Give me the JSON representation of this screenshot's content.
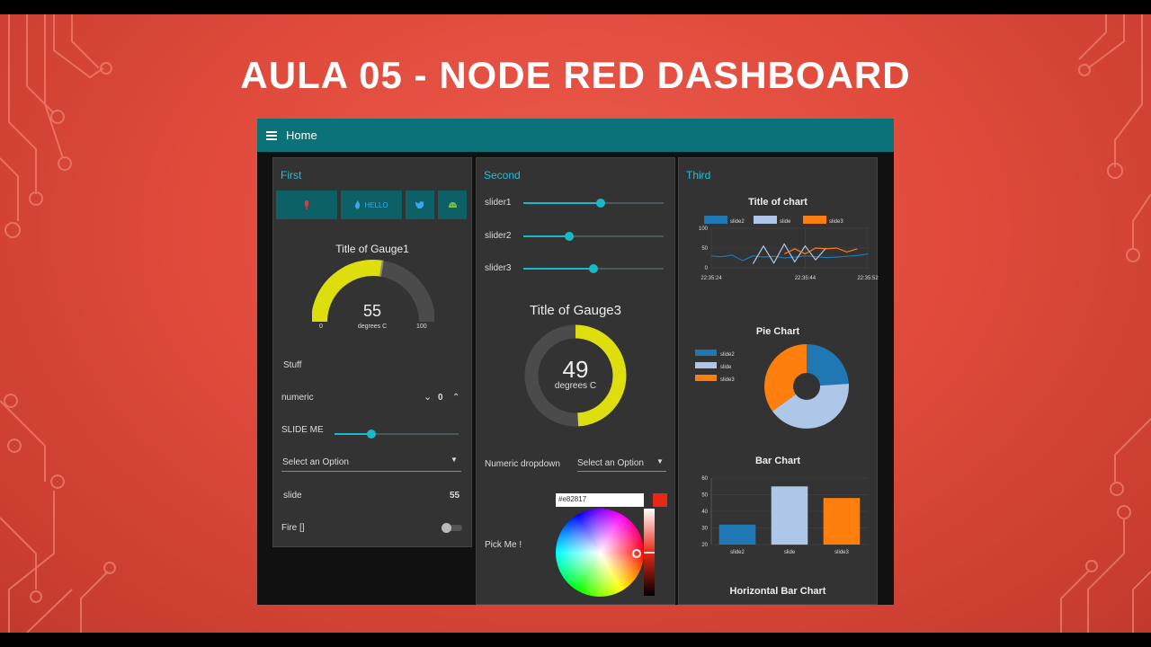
{
  "slide": {
    "title": "AULA 05 - NODE RED DASHBOARD"
  },
  "topbar": {
    "title": "Home",
    "menu_icon": "hamburger-icon"
  },
  "first": {
    "title": "First",
    "buttons": [
      {
        "icon": "microphone-icon",
        "label": "",
        "color": "#e53935"
      },
      {
        "icon": "fire-icon",
        "label": "HELLO",
        "color": "#3aa7e8"
      },
      {
        "icon": "twitter-icon",
        "label": "",
        "color": "#3aa7e8"
      },
      {
        "icon": "android-icon",
        "label": "",
        "color": "#7cc242"
      }
    ],
    "gauge": {
      "title": "Title of Gauge1",
      "value": "55",
      "units": "degrees C",
      "min": "0",
      "max": "100",
      "fraction": 0.55
    },
    "stuff": "Stuff",
    "numeric": {
      "label": "numeric",
      "value": "0"
    },
    "slide_me": {
      "label": "SLIDE ME",
      "fraction": 0.3
    },
    "dropdown": {
      "placeholder": "Select an Option"
    },
    "slide": {
      "label": "slide",
      "value": "55"
    },
    "fire": {
      "label": "Fire []"
    }
  },
  "second": {
    "title": "Second",
    "sliders": [
      {
        "label": "slider1",
        "fraction": 0.55
      },
      {
        "label": "slider2",
        "fraction": 0.33
      },
      {
        "label": "slider3",
        "fraction": 0.5
      }
    ],
    "gauge": {
      "title": "Title of Gauge3",
      "value": "49",
      "units": "degrees C",
      "fraction": 0.49
    },
    "numeric_dropdown": {
      "label": "Numeric dropdown",
      "placeholder": "Select an Option"
    },
    "color_picker": {
      "label": "Pick Me !",
      "hex": "#e82817",
      "color": "#e82817"
    }
  },
  "third": {
    "title": "Third",
    "line_chart": {
      "title": "Title of chart",
      "legend": [
        "slide2",
        "slide",
        "slide3"
      ],
      "y_ticks": [
        "100",
        "50",
        "0"
      ],
      "x_ticks": [
        "22:35:24",
        "22:35:44",
        "22:35:52"
      ]
    },
    "pie_chart": {
      "title": "Pie Chart",
      "legend": [
        "slide2",
        "slide",
        "slide3"
      ]
    },
    "bar_chart": {
      "title": "Bar Chart",
      "y_ticks": [
        "60",
        "50",
        "40",
        "30",
        "20"
      ],
      "categories": [
        "slide2",
        "slide",
        "slide3"
      ]
    },
    "hbar_chart": {
      "title": "Horizontal Bar Chart"
    }
  },
  "chart_data": [
    {
      "type": "line",
      "title": "Title of chart",
      "x_ticks": [
        "22:35:24",
        "22:35:44",
        "22:35:52"
      ],
      "ylim": [
        0,
        100
      ],
      "series": [
        {
          "name": "slide2",
          "color": "#1f77b4",
          "values": [
            30,
            28,
            32,
            18,
            30,
            27,
            29,
            25,
            27,
            30,
            28,
            26,
            27,
            29,
            31,
            35
          ]
        },
        {
          "name": "slide",
          "color": "#aec7e8",
          "values": [
            null,
            null,
            null,
            null,
            10,
            55,
            12,
            60,
            15,
            55,
            20,
            50,
            null,
            null,
            null,
            null
          ]
        },
        {
          "name": "slide3",
          "color": "#ff7f0e",
          "values": [
            null,
            null,
            null,
            null,
            null,
            null,
            null,
            35,
            48,
            35,
            50,
            48,
            50,
            40,
            48,
            null
          ]
        }
      ],
      "legend": "top",
      "grid": true
    },
    {
      "type": "pie",
      "title": "Pie Chart",
      "series": [
        {
          "name": "slide2",
          "value": 24,
          "color": "#1f77b4"
        },
        {
          "name": "slide",
          "value": 41,
          "color": "#aec7e8"
        },
        {
          "name": "slide3",
          "value": 35,
          "color": "#ff7f0e"
        }
      ],
      "legend": "left"
    },
    {
      "type": "bar",
      "title": "Bar Chart",
      "categories": [
        "slide2",
        "slide",
        "slide3"
      ],
      "values": [
        32,
        55,
        48
      ],
      "colors": [
        "#1f77b4",
        "#aec7e8",
        "#ff7f0e"
      ],
      "ylim": [
        20,
        60
      ],
      "grid": true
    }
  ]
}
